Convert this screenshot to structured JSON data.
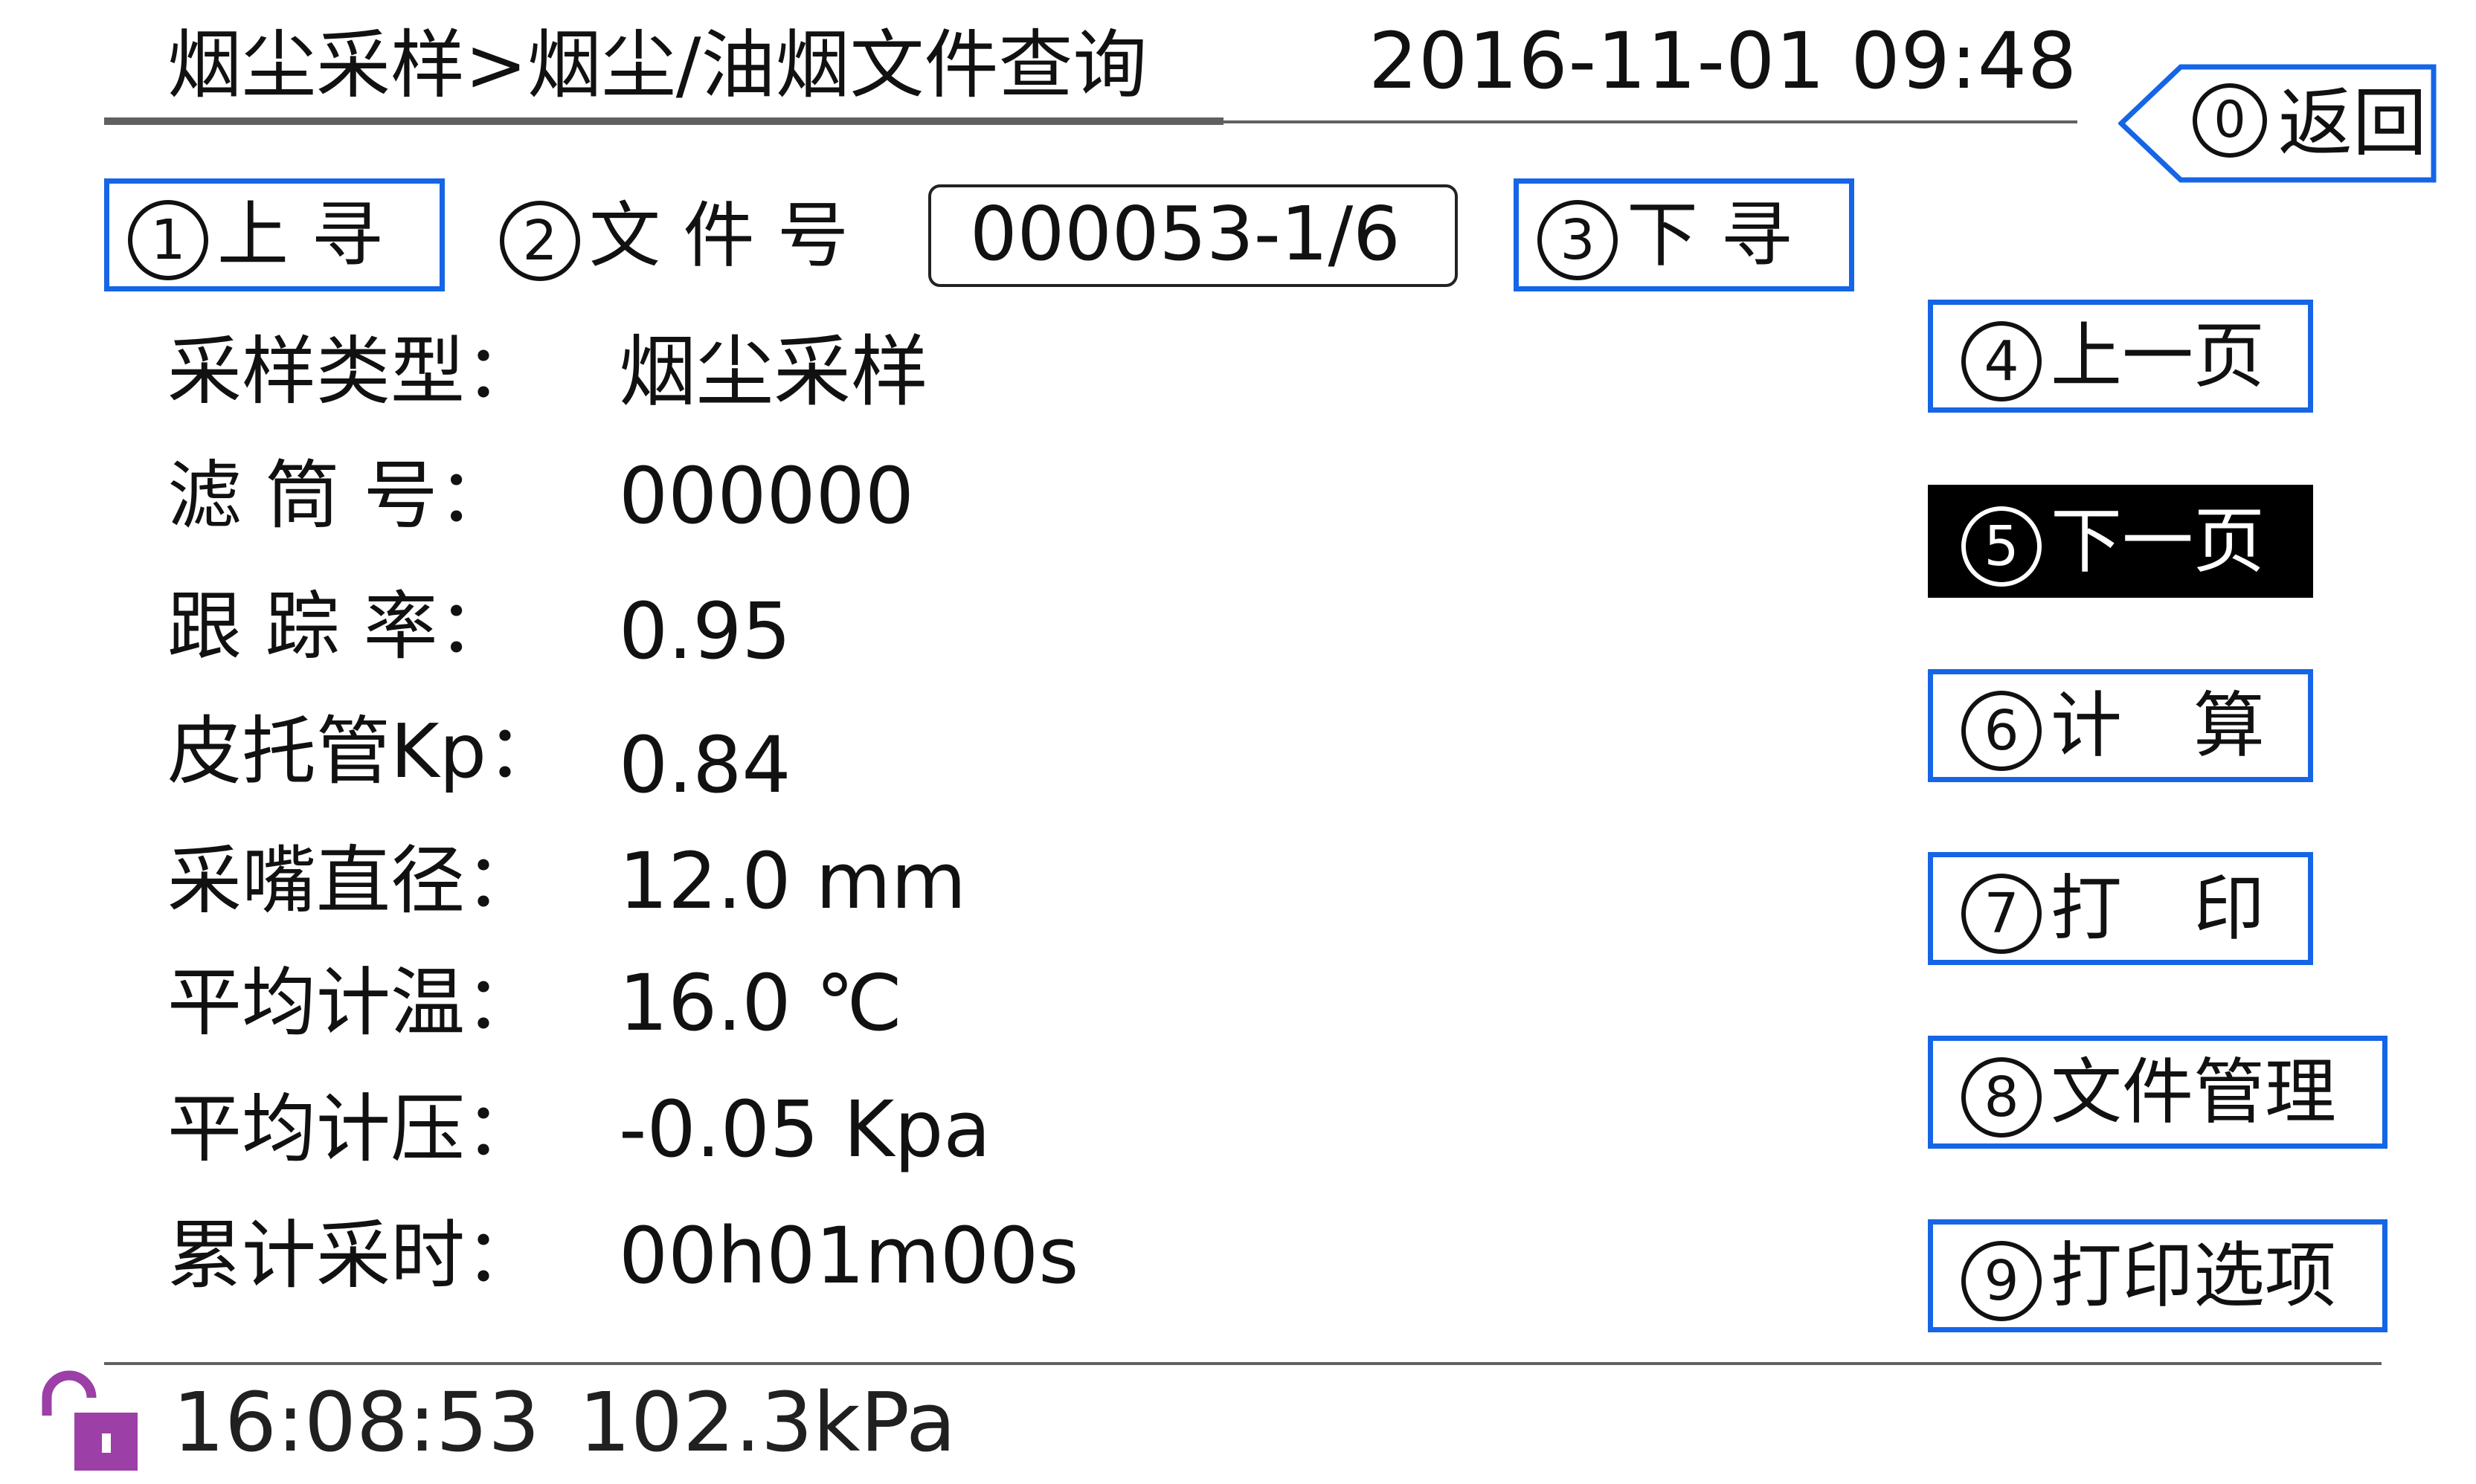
{
  "header": {
    "title": "烟尘采样>烟尘/油烟文件查询",
    "datetime": "2016-11-01  09:48"
  },
  "back_button": {
    "number": "0",
    "label": "返回"
  },
  "search_row": {
    "prev_search": {
      "number": "1",
      "label": "上 寻"
    },
    "file_no_label": {
      "number": "2",
      "label": "文 件 号"
    },
    "file_no_value": "000053-1/6",
    "next_search": {
      "number": "3",
      "label": "下 寻"
    }
  },
  "fields": [
    {
      "label": "采样类型：",
      "value": "烟尘采样"
    },
    {
      "label": "滤 筒 号：",
      "value": "000000"
    },
    {
      "label": "跟 踪 率：",
      "value": "0.95"
    },
    {
      "label": "皮托管Kp：",
      "value": "0.84"
    },
    {
      "label": "采嘴直径：",
      "value": "12.0  mm"
    },
    {
      "label": "平均计温：",
      "value": "16.0  ℃"
    },
    {
      "label": "平均计压：",
      "value": "-0.05 Kpa"
    },
    {
      "label": "累计采时：",
      "value": "00h01m00s"
    }
  ],
  "side_buttons": [
    {
      "number": "4",
      "label": "上一页"
    },
    {
      "number": "5",
      "label": "下一页",
      "selected": true
    },
    {
      "number": "6",
      "label": "计　算"
    },
    {
      "number": "7",
      "label": "打　印"
    },
    {
      "number": "8",
      "label": "文件管理"
    },
    {
      "number": "9",
      "label": "打印选项"
    }
  ],
  "status_bar": {
    "lock_icon": "unlocked-padlock-icon",
    "time": "16:08:53",
    "pressure": "102.3kPa"
  },
  "colors": {
    "button_border": "#1565e6",
    "selected_bg": "#000000",
    "lock_icon": "#9c3fa6"
  }
}
